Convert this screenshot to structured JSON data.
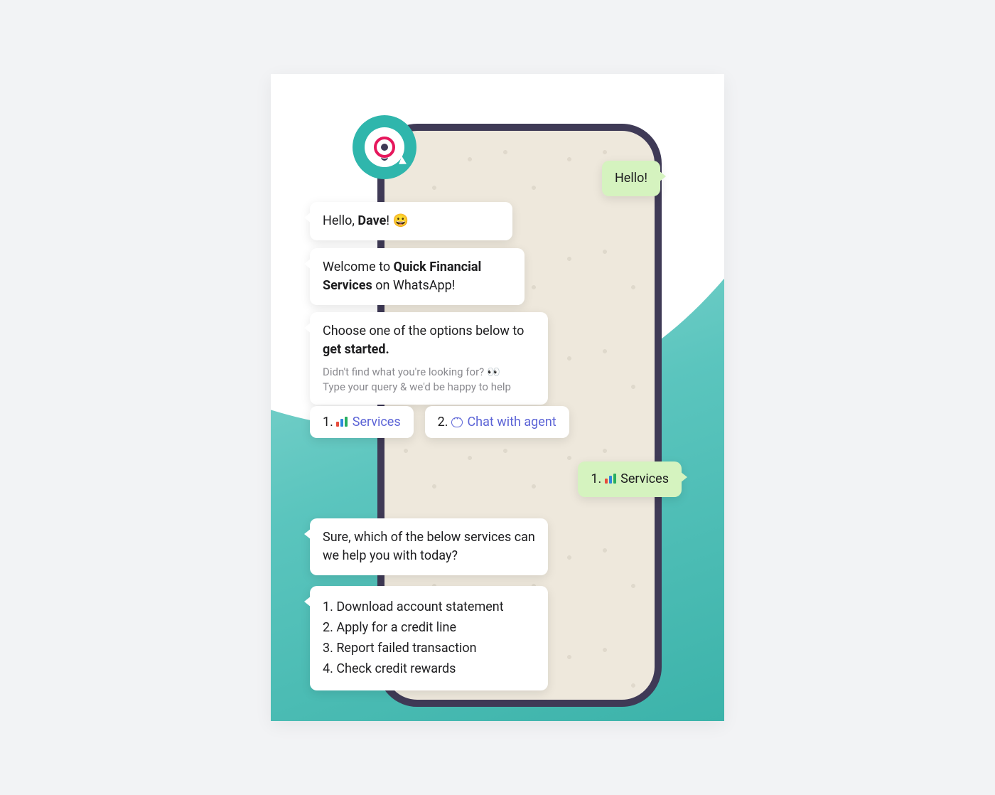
{
  "user_msgs": {
    "hello": "Hello!",
    "pick_services_num": "1. ",
    "pick_services_lbl": "Services"
  },
  "bot_msgs": {
    "greet_pre": "Hello, ",
    "greet_name": "Dave",
    "greet_post": "! 😀",
    "welcome_pre": "Welcome to ",
    "welcome_bold": "Quick Financial Services",
    "welcome_post": " on WhatsApp!",
    "choose_line1": "Choose one of the options below to ",
    "choose_line2": "get started.",
    "sub_line1": "Didn't find what you're looking for? 👀",
    "sub_line2": "Type your query & we'd be happy to help",
    "followup": "Sure, which of the below services can we help you with today?"
  },
  "quick_replies": {
    "opt1_num": "1. ",
    "opt1_label": "Services",
    "opt2_num": "2. ",
    "opt2_label": "Chat with agent"
  },
  "services": {
    "s1": "1. Download account statement",
    "s2": "2. Apply for a credit line",
    "s3": "3. Report failed transaction",
    "s4": "4. Check credit rewards"
  }
}
